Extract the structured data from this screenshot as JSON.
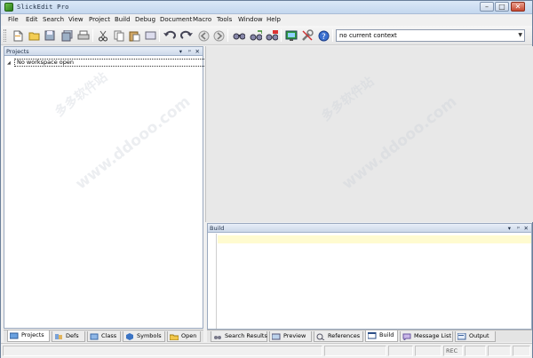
{
  "window": {
    "title": "SlickEdit Pro",
    "min": "–",
    "max": "□",
    "close": "✕"
  },
  "menu": [
    "File",
    "Edit",
    "Search",
    "View",
    "Project",
    "Build",
    "Debug",
    "Document",
    "Macro",
    "Tools",
    "Window",
    "Help"
  ],
  "toolbar": {
    "icons": [
      "new-file-icon",
      "open-folder-icon",
      "save-icon",
      "save-all-icon",
      "print-icon",
      "cut-icon",
      "copy-icon",
      "paste-icon",
      "select-all-icon",
      "undo-icon",
      "redo-icon",
      "back-icon",
      "forward-icon",
      "find-icon",
      "find-next-icon",
      "replace-icon",
      "monitor-icon",
      "tools-icon",
      "help-icon"
    ],
    "context_value": "no current context"
  },
  "projects_panel": {
    "title": "Projects",
    "controls": [
      "▾",
      "ᵖ",
      "✕"
    ],
    "tree_root": "No workspace open",
    "tabs": [
      "Projects",
      "Defs",
      "Class",
      "Symbols",
      "Open"
    ]
  },
  "build_panel": {
    "title": "Build",
    "controls": [
      "▾",
      "ᵖ",
      "✕"
    ],
    "tabs": [
      "Search Results",
      "Preview",
      "References",
      "Build",
      "Message List",
      "Output"
    ]
  },
  "status": {
    "rec": "REC"
  },
  "watermarks": [
    "多多软件站",
    "www.ddooo.com"
  ],
  "colors": {
    "title_bg": "#c4d7ee",
    "current_line": "#fffbd0",
    "panel_border": "#9aa9bf"
  }
}
